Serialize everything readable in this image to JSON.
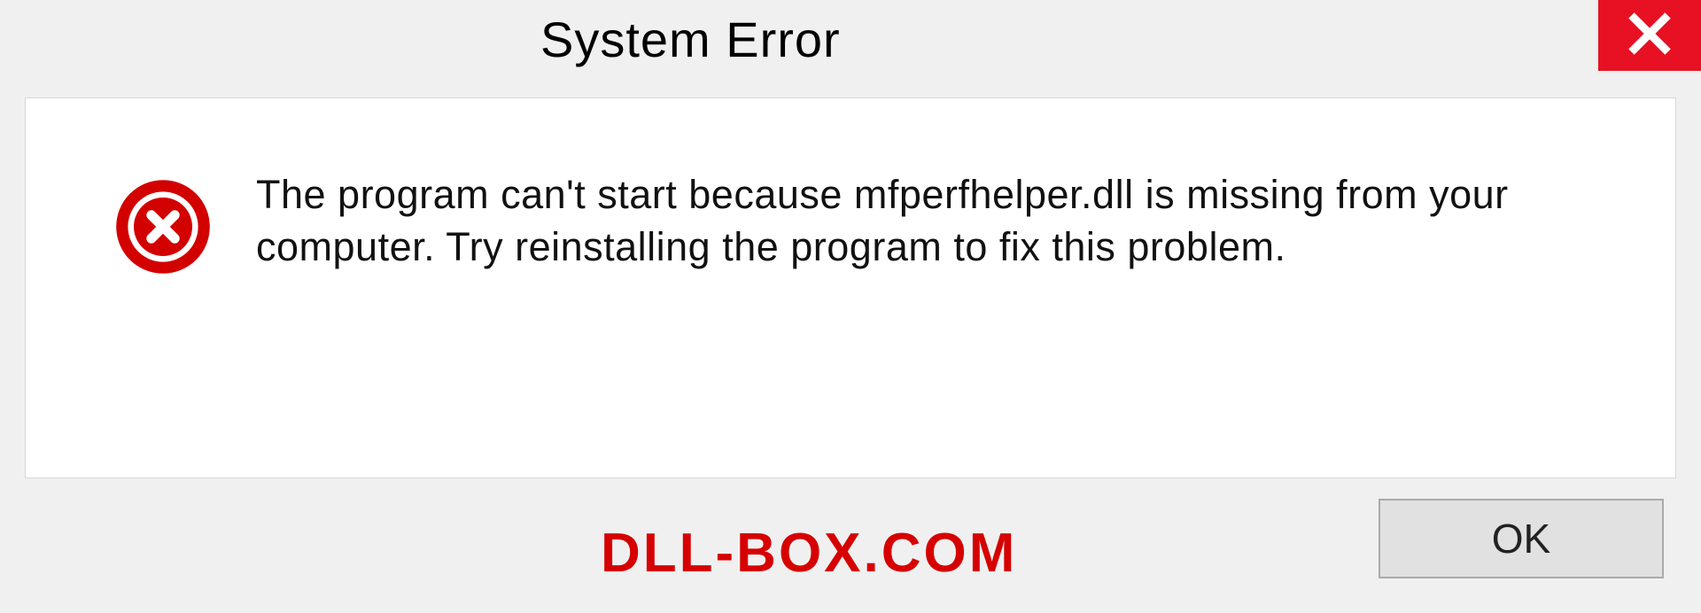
{
  "dialog": {
    "title": "System Error",
    "message": "The program can't start because mfperfhelper.dll is missing from your computer. Try reinstalling the program to fix this problem.",
    "ok_label": "OK"
  },
  "watermark": "DLL-BOX.COM",
  "colors": {
    "close_bg": "#e81123",
    "error_icon": "#d30000",
    "watermark": "#d60000"
  }
}
